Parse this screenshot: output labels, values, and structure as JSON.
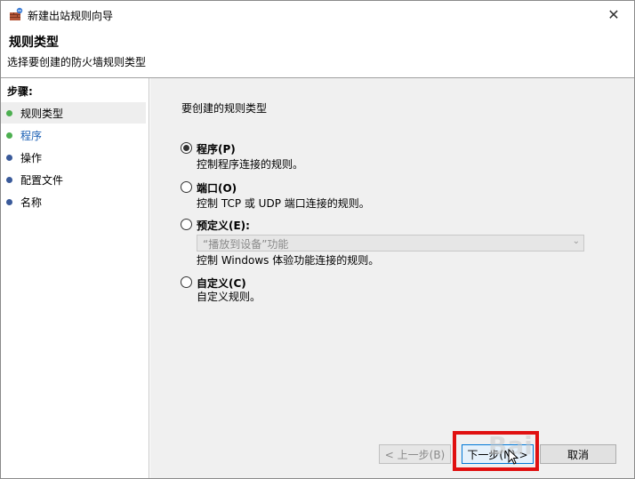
{
  "window": {
    "title": "新建出站规则向导",
    "close_glyph": "✕"
  },
  "header": {
    "title": "规则类型",
    "subtitle": "选择要创建的防火墙规则类型"
  },
  "sidebar": {
    "steps_title": "步骤:",
    "items": [
      {
        "label": "规则类型",
        "dot_color": "#4caf50",
        "active": true
      },
      {
        "label": "程序",
        "dot_color": "#4caf50",
        "active": false
      },
      {
        "label": "操作",
        "dot_color": "#3a5a9a",
        "active": false
      },
      {
        "label": "配置文件",
        "dot_color": "#3a5a9a",
        "active": false
      },
      {
        "label": "名称",
        "dot_color": "#3a5a9a",
        "active": false
      }
    ]
  },
  "main": {
    "prompt": "要创建的规则类型",
    "options": [
      {
        "label": "程序(P)",
        "desc": "控制程序连接的规则。",
        "checked": true
      },
      {
        "label": "端口(O)",
        "desc": "控制 TCP 或 UDP 端口连接的规则。",
        "checked": false
      },
      {
        "label": "预定义(E):",
        "desc": "控制 Windows 体验功能连接的规则。",
        "checked": false
      },
      {
        "label": "自定义(C)",
        "desc": "自定义规则。",
        "checked": false
      }
    ],
    "predefined_select": {
      "value": "“播放到设备”功能",
      "disabled": true
    }
  },
  "footer": {
    "back_label": "< 上一步(B)",
    "next_label": "下一步(N) >",
    "cancel_label": "取消"
  },
  "watermark": "Bai"
}
